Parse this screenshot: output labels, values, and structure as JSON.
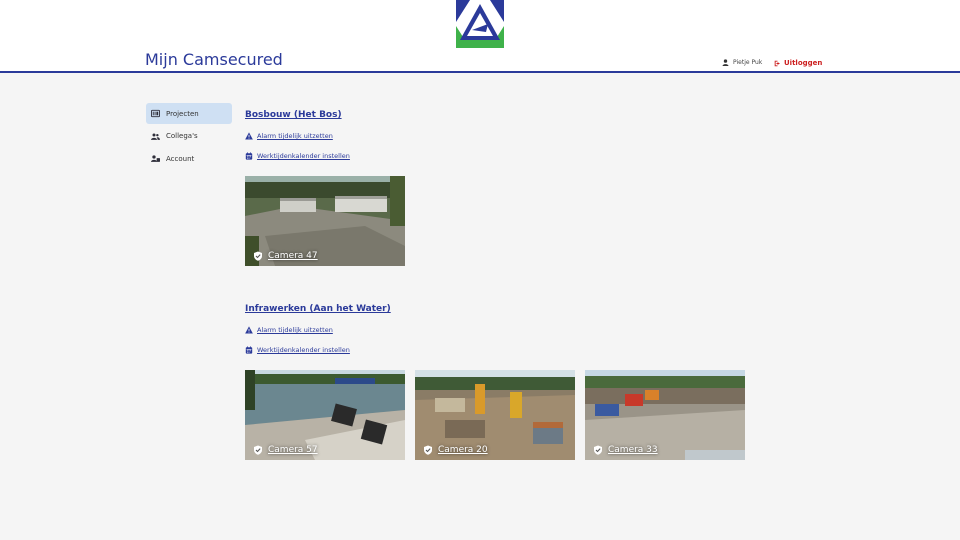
{
  "header": {
    "app_title": "Mijn Camsecured",
    "user_name": "Pietje Puk",
    "logout_label": "Uitloggen",
    "colors": {
      "brand_blue": "#2b3a9a",
      "logo_green": "#3fb24a",
      "logout_red": "#cc1f1f"
    }
  },
  "sidebar": {
    "items": [
      {
        "label": "Projecten",
        "icon": "projects-icon",
        "active": true
      },
      {
        "label": "Collega's",
        "icon": "users-icon",
        "active": false
      },
      {
        "label": "Account",
        "icon": "account-icon",
        "active": false
      }
    ]
  },
  "projects": [
    {
      "title": "Bosbouw (Het Bos)",
      "alarm_label": "Alarm tijdelijk uitzetten",
      "calendar_label": "Werktijdenkalender instellen",
      "cameras": [
        {
          "label": "Camera 47"
        }
      ]
    },
    {
      "title": "Infrawerken (Aan het Water)",
      "alarm_label": "Alarm tijdelijk uitzetten",
      "calendar_label": "Werktijdenkalender instellen",
      "cameras": [
        {
          "label": "Camera 57"
        },
        {
          "label": "Camera 20"
        },
        {
          "label": "Camera 33"
        }
      ]
    }
  ]
}
